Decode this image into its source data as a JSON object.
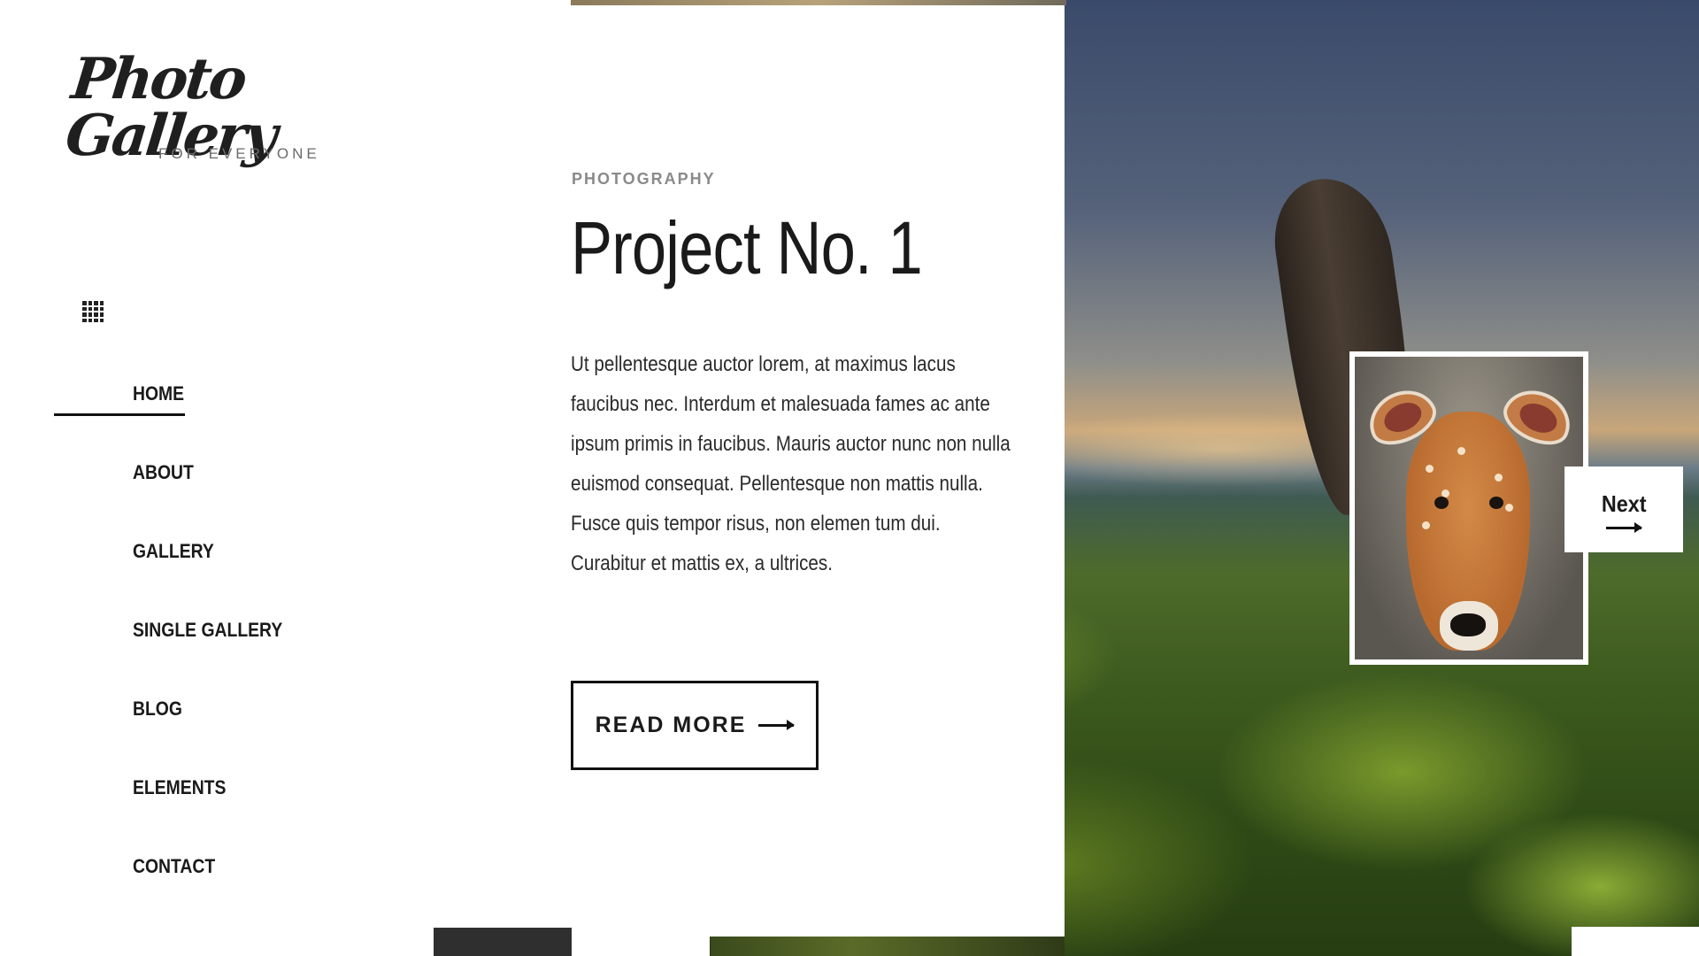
{
  "brand": {
    "logo_text": "Photo Gallery",
    "tagline": "FOR EVERYONE"
  },
  "nav": {
    "items": [
      {
        "label": "HOME",
        "active": true
      },
      {
        "label": "ABOUT"
      },
      {
        "label": "GALLERY"
      },
      {
        "label": "SINGLE GALLERY"
      },
      {
        "label": "BLOG"
      },
      {
        "label": "ELEMENTS"
      },
      {
        "label": "CONTACT"
      }
    ]
  },
  "icons": {
    "menu": "grid-menu-icon",
    "read_more_arrow": "arrow-right-icon",
    "next_arrow": "arrow-right-icon"
  },
  "project": {
    "category": "PHOTOGRAPHY",
    "title": "Project No. 1",
    "excerpt": "Ut pellentesque auctor lorem, at maximus lacus faucibus nec. Interdum et malesuada fames ac ante ipsum primis in faucibus. Mauris auctor nunc non nulla euismod consequat. Pellentesque non mattis nulla. Fusce quis tempor risus, non elemen tum dui. Curabitur et mattis ex, a ultrices.",
    "read_more_label": "READ MORE"
  },
  "slider": {
    "next_label": "Next"
  },
  "colors": {
    "text": "#1a1a1a",
    "muted": "#8a8a8a",
    "accent_dark": "#2f2f2f",
    "background": "#ffffff"
  }
}
